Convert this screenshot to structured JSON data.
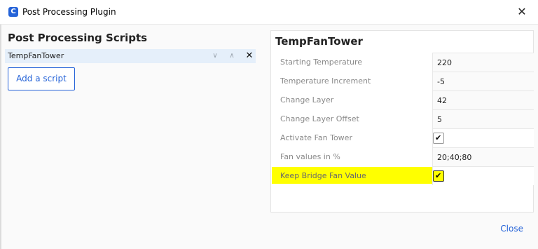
{
  "window": {
    "title": "Post Processing Plugin",
    "close_glyph": "✕"
  },
  "left_panel": {
    "title": "Post Processing Scripts",
    "scripts": [
      {
        "name": "TempFanTower"
      }
    ],
    "controls": {
      "down": "∨",
      "up": "∧",
      "remove": "✕"
    },
    "add_button": "Add a script"
  },
  "settings": {
    "title": "TempFanTower",
    "rows": [
      {
        "label": "Starting Temperature",
        "value": "220"
      },
      {
        "label": "Temperature Increment",
        "value": "-5"
      },
      {
        "label": "Change Layer",
        "value": "42"
      },
      {
        "label": "Change Layer Offset",
        "value": "5"
      },
      {
        "label": "Activate Fan Tower",
        "checked": true
      },
      {
        "label": "Fan values in %",
        "value": "20;40;80"
      },
      {
        "label": "Keep Bridge Fan Value",
        "checked": true,
        "highlighted": true
      }
    ],
    "check_glyph": "✔"
  },
  "footer": {
    "close_button": "Close"
  },
  "colors": {
    "accent": "#2563d8",
    "highlight": "#ffff00",
    "selection": "#e5effa"
  }
}
